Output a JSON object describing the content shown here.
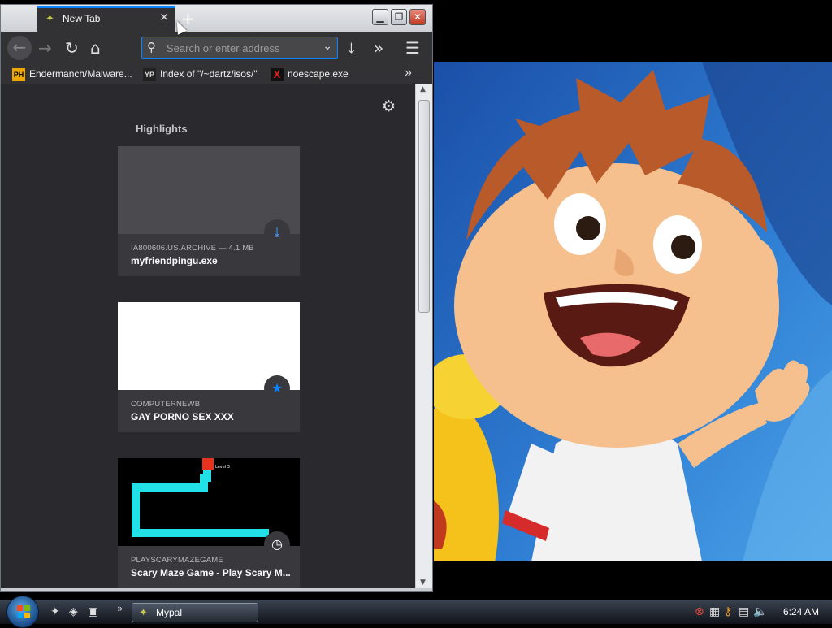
{
  "browser": {
    "tab": {
      "title": "New Tab",
      "close": "✕"
    },
    "newtab": "+",
    "window_buttons": {
      "minimize": "▁",
      "maximize": "❐",
      "close": "✕"
    },
    "nav": {
      "back": "←",
      "forward": "→",
      "reload": "↻",
      "home": "⌂",
      "download": "⤓",
      "overflow": "»",
      "menu": "☰"
    },
    "url_bar": {
      "value": "",
      "placeholder": "Search or enter address",
      "search_icon": "⚲",
      "dropdown": "⌄"
    },
    "bookmarks": [
      {
        "favicon": "PH",
        "label": "Endermanch/Malware..."
      },
      {
        "favicon": "YP",
        "label": "Index of \"/~dartz/isos/\""
      },
      {
        "favicon": "X",
        "label": "noescape.exe"
      }
    ],
    "bookmarks_more": "»"
  },
  "newtab_page": {
    "settings_icon": "⚙",
    "highlights_title": "Highlights",
    "cards": [
      {
        "source": "IA800606.US.ARCHIVE — 4.1 MB",
        "title": "myfriendpingu.exe",
        "badge": "⤓",
        "badge_color": "#45a1ff"
      },
      {
        "source": "COMPUTERNEWB",
        "title": "GAY PORNO SEX XXX",
        "badge": "★",
        "badge_color": "#0a84ff"
      },
      {
        "source": "PLAYSCARYMAZEGAME",
        "title": "Scary Maze Game - Play Scary M...",
        "badge": "◷",
        "badge_color": "#ffffff",
        "thumb_label": "Level 3"
      }
    ]
  },
  "scrollbar": {
    "up": "▲",
    "down": "▼"
  },
  "taskbar": {
    "quick_launch": [
      "✦",
      "◈",
      "▣"
    ],
    "quick_more": "»",
    "task": {
      "label": "Mypal"
    },
    "tray_icons": [
      "⊗",
      "▦",
      "⚷",
      "▤",
      "🔈"
    ],
    "clock": "6:24 AM"
  },
  "colors": {
    "accent": "#0a84ff",
    "content_bg": "#2a2a2e",
    "card_bg": "#38383d"
  }
}
